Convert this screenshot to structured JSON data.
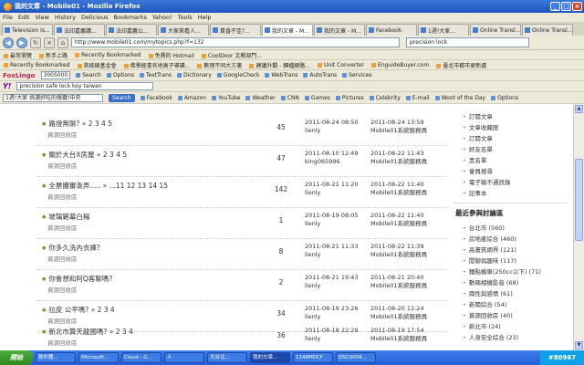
{
  "window": {
    "title": "我的文章 - Mobile01 - Mozilla Firefox"
  },
  "menu": [
    "File",
    "Edit",
    "View",
    "History",
    "Delicious",
    "Bookmarks",
    "Yahoo!",
    "Tools",
    "Help"
  ],
  "tabs": [
    {
      "label": "Television Is..."
    },
    {
      "label": "法印嘉義講..."
    },
    {
      "label": "法印嘉義公..."
    },
    {
      "label": "大家來看人..."
    },
    {
      "label": "黃昏不佳?..."
    },
    {
      "label": "我的文章 - M...",
      "active": true
    },
    {
      "label": "我的文章 - M..."
    },
    {
      "label": "Facebook"
    },
    {
      "label": "1週!大家..."
    },
    {
      "label": "Online Transl..."
    },
    {
      "label": "Online Transl..."
    }
  ],
  "nav": {
    "url": "http://www.mobile01.com/mytopics.php?f=132",
    "search": "precision lock"
  },
  "bookmarks1": [
    "最常瀏覽",
    "新手上路",
    "Recently Bookmarked",
    "免費的 Hotmail",
    "CoolDoor 文教部門..."
  ],
  "bookmarks2": [
    "Recently Bookmarked",
    "首條線基金會",
    "佛學經書名地高子導讀...",
    "數理不同大方裏",
    "建議外觀 - 歸檔網路...",
    "Unit Converter",
    "EnguideBuyer.com",
    "臺北市都市更新處"
  ],
  "toolbar1": {
    "brand": "FoxLingo",
    "select": "3005000",
    "items": [
      "Search",
      "Options",
      "TextTrans",
      "Dictionary",
      "GoogleCheck",
      "WebTrans",
      "AutoTrans",
      "Services"
    ]
  },
  "toolbar2": {
    "brand": "Y!",
    "search": "precision safe lock key taiwan"
  },
  "toolbar3": {
    "select": "1週!大家 挑選好吃的餐廳!中央",
    "search_label": "Search",
    "items": [
      "Facebook",
      "Amazon",
      "YouTube",
      "Weather",
      "CNN",
      "Games",
      "Pictures",
      "Celebrity",
      "E-mail",
      "Woot of the Day"
    ],
    "options": "Options"
  },
  "threads": [
    {
      "title": "路燈無聊? » 2 3 4 5",
      "forum": "資源回收區",
      "count": "45",
      "post_date": "2011-08-24 08:50",
      "post_user": "lienly",
      "last_date": "2011-08-24 13:59",
      "last_user": "Mobile01系統服務員"
    },
    {
      "title": "關於大台X房屋 » 2 3 4 5",
      "forum": "資源回收區",
      "count": "47",
      "post_date": "2011-08-10 12:49",
      "post_user": "king065996",
      "last_date": "2011-08-22 11:43",
      "last_user": "Mobile01系統服務員"
    },
    {
      "title": "全票攤審漸弄..... » ...11 12 13 14 15",
      "forum": "資源回收區",
      "count": "142",
      "post_date": "2011-08-21 11:20",
      "post_user": "lienly",
      "last_date": "2011-08-22 11:40",
      "last_user": "Mobile01系統服務員"
    },
    {
      "title": "玻璃鏟幕白楊",
      "forum": "資源回收區",
      "count": "1",
      "post_date": "2011-08-19 08:05",
      "post_user": "lienly",
      "last_date": "2011-08-22 11:40",
      "last_user": "Mobile01系統服務員"
    },
    {
      "title": "你多久洗內衣褲?",
      "forum": "資源回收區",
      "count": "8",
      "post_date": "2011-08-21 11:33",
      "post_user": "lienly",
      "last_date": "2011-08-22 11:39",
      "last_user": "Mobile01系統服務員"
    },
    {
      "title": "你會想和阿Q客聊嗎?",
      "forum": "資源回收區",
      "count": "2",
      "post_date": "2011-08-21 19:43",
      "post_user": "lienly",
      "last_date": "2011-08-21 20:40",
      "last_user": "Mobile01系統服務員"
    },
    {
      "title": "拉皮 公平嗎? » 2 3 4",
      "forum": "資源回收區",
      "count": "34",
      "post_date": "2011-08-19 23:26",
      "post_user": "lienly",
      "last_date": "2011-08-20 12:24",
      "last_user": "Mobile01系統服務員"
    },
    {
      "title": "新北市算天龍國嗎? » 2 3 4",
      "forum": "資源回收區",
      "count": "36",
      "post_date": "2011-08-18 22:29",
      "post_user": "lienly",
      "last_date": "2011-08-19 17:54",
      "last_user": "Mobile01系統服務員"
    }
  ],
  "sidebar": {
    "top_links": [
      "訂閱文章",
      "文章收藏匣",
      "訂閱文章",
      "好友名單",
      "黑名單",
      "會員搜尋",
      "電子報不通訊錄",
      "記事本"
    ],
    "heading": "最近參與討論區",
    "forums": [
      "台北市 (560)",
      "房地產綜合 (460)",
      "高畫質網界 (121)",
      "閒聊與趣味 (117)",
      "麵點機車(250cc以下) (71)",
      "數碼相機影音 (68)",
      "兩性與感情 (61)",
      "新聞綜合 (54)",
      "資源回收區 (40)",
      "新北市 (24)",
      "人身安全綜合 (23)"
    ]
  },
  "taskbar": {
    "start": "開始",
    "tasks": [
      "軟件體...",
      "Microsoft...",
      "Cloud - G...",
      "人",
      "大台北...",
      "我的文章...",
      "1148MDCF",
      "DSC0004..."
    ],
    "tray": "#80967"
  }
}
